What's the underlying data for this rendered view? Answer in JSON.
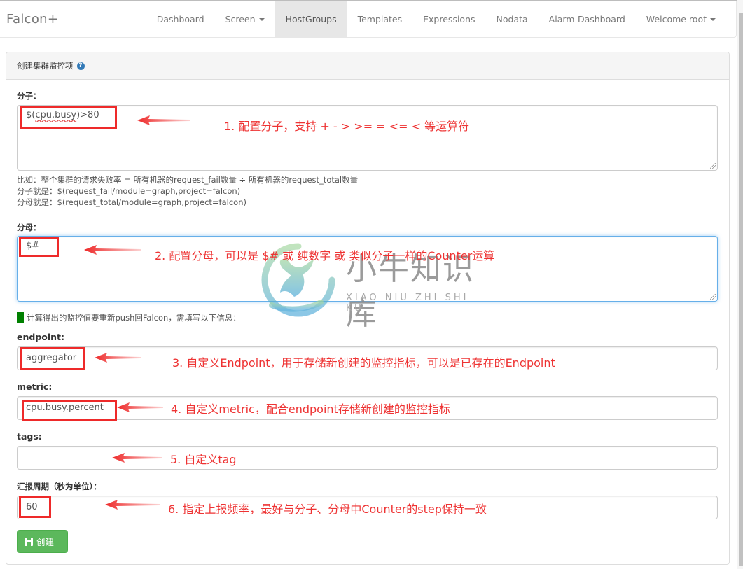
{
  "navbar": {
    "brand": "Falcon+",
    "items": [
      {
        "label": "Dashboard",
        "dropdown": false,
        "active": false
      },
      {
        "label": "Screen",
        "dropdown": true,
        "active": false
      },
      {
        "label": "HostGroups",
        "dropdown": false,
        "active": true
      },
      {
        "label": "Templates",
        "dropdown": false,
        "active": false
      },
      {
        "label": "Expressions",
        "dropdown": false,
        "active": false
      },
      {
        "label": "Nodata",
        "dropdown": false,
        "active": false
      },
      {
        "label": "Alarm-Dashboard",
        "dropdown": false,
        "active": false
      },
      {
        "label": "Welcome root",
        "dropdown": true,
        "active": false
      }
    ]
  },
  "panel": {
    "title": "创建集群监控项",
    "help_icon": "question-circle-icon"
  },
  "form": {
    "numerator": {
      "label": "分子：",
      "value_prefix": "$(",
      "value_underlined": "cpu.busy",
      "value_suffix": ")>80"
    },
    "hint": {
      "line1": "比如：整个集群的请求失败率 = 所有机器的request_fail数量 ÷ 所有机器的request_total数量",
      "line2": "分子就是：$(request_fail/module=graph,project=falcon)",
      "line3": "分母就是：$(request_total/module=graph,project=falcon)"
    },
    "denominator": {
      "label": "分母：",
      "value": "$#"
    },
    "push_note": "计算得出的监控值要重新push回Falcon，需填写以下信息：",
    "endpoint": {
      "label": "endpoint:",
      "value": "aggregator"
    },
    "metric": {
      "label": "metric:",
      "value": "cpu.busy.percent"
    },
    "tags": {
      "label": "tags:",
      "value": ""
    },
    "step": {
      "label": "汇报周期（秒为单位）：",
      "value": "60"
    },
    "submit_label": "创建",
    "submit_icon": "floppy-save-icon"
  },
  "annotations": {
    "a1": "1. 配置分子，支持 + - > >= = <= < 等运算符",
    "a2": "2. 配置分母，可以是 $# 或 纯数字 或 类似分子一样的Counter运算",
    "a3": "3. 自定义Endpoint，用于存储新创建的监控指标，可以是已存在的Endpoint",
    "a4": "4. 自定义metric，配合endpoint存储新创建的监控指标",
    "a5": "5. 自定义tag",
    "a6": "6. 指定上报频率，最好与分子、分母中Counter的step保持一致"
  },
  "watermark": {
    "title": "小牛知识库",
    "subtitle": "XIAO NIU ZHI SHI KU"
  },
  "colors": {
    "annotation_red": "#ee3333",
    "button_green": "#5cb85c",
    "note_green": "#008000",
    "active_nav_bg": "#e7e7e7"
  }
}
